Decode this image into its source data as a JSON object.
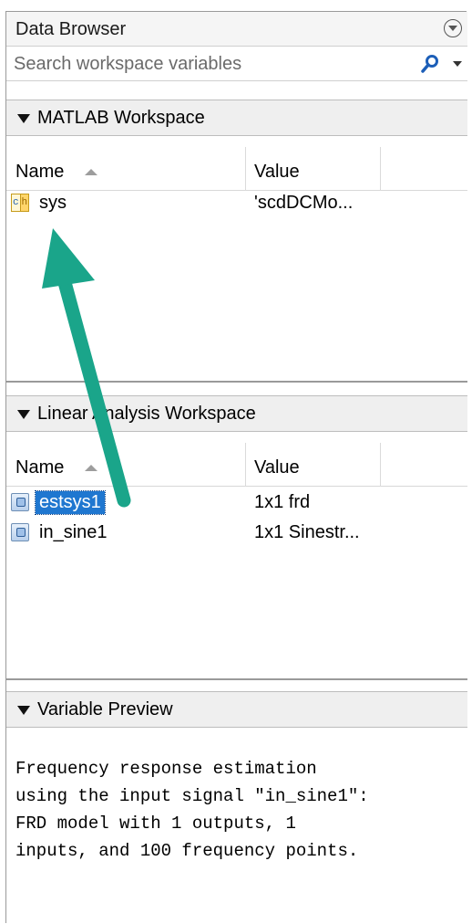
{
  "panel": {
    "title": "Data Browser"
  },
  "search": {
    "placeholder": "Search workspace variables"
  },
  "matlab_workspace": {
    "title": "MATLAB Workspace",
    "columns": [
      "Name",
      "Value"
    ],
    "rows": [
      {
        "name": "sys",
        "value": "'scdDCMo...",
        "icon": "char-icon"
      }
    ]
  },
  "linear_workspace": {
    "title": "Linear Analysis Workspace",
    "columns": [
      "Name",
      "Value"
    ],
    "rows": [
      {
        "name": "estsys1",
        "value": "1x1 frd",
        "icon": "object-icon",
        "selected": true
      },
      {
        "name": "in_sine1",
        "value": "1x1 Sinestr...",
        "icon": "object-icon",
        "selected": false
      }
    ]
  },
  "variable_preview": {
    "title": "Variable Preview",
    "text": "Frequency response estimation\nusing the input signal \"in_sine1\":\nFRD model with 1 outputs, 1\ninputs, and 100 frequency points."
  },
  "annotation": {
    "arrow_color": "#1aa58a"
  }
}
